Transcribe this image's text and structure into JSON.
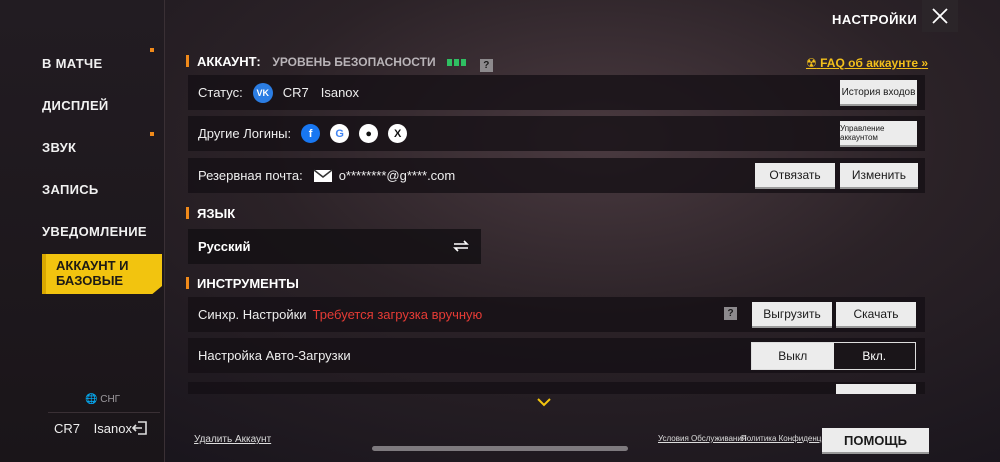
{
  "sidebar": {
    "items": [
      {
        "label": "В МАТЧЕ"
      },
      {
        "label": "ДИСПЛЕЙ"
      },
      {
        "label": "ЗВУК"
      },
      {
        "label": "ЗАПИСЬ"
      },
      {
        "label": "УВЕДОМЛЕНИЕ"
      },
      {
        "label_line1": "АККАУНТ И",
        "label_line2": "БАЗОВЫЕ"
      }
    ],
    "region": "СНГ",
    "user": {
      "clan": "CR7",
      "name": "Isanox"
    }
  },
  "header": {
    "title": "НАСТРОЙКИ"
  },
  "account": {
    "section_title": "АККАУНТ:",
    "security_label": "УРОВЕНЬ БЕЗОПАСНОСТИ",
    "faq_link": "FAQ об аккаунте",
    "status": {
      "label": "Статус:",
      "clan": "CR7",
      "name": "Isanox",
      "vk": "VK",
      "history_button": "История входов"
    },
    "other_logins": {
      "label": "Другие Логины:",
      "manage_button": "Управление аккаунтом"
    },
    "backup_email": {
      "label": "Резервная почта:",
      "value": "o********@g****.com",
      "unbind_button": "Отвязать",
      "change_button": "Изменить"
    }
  },
  "language": {
    "section_title": "ЯЗЫК",
    "current": "Русский"
  },
  "tools": {
    "section_title": "ИНСТРУМЕНТЫ",
    "sync": {
      "label": "Синхр. Настройки",
      "warning": "Требуется загрузка вручную",
      "upload_button": "Выгрузить",
      "download_button": "Скачать"
    },
    "auto_download": {
      "label": "Настройка Авто-Загрузки",
      "off": "Выкл",
      "on": "Вкл."
    }
  },
  "footer": {
    "delete_account": "Удалить Аккаунт",
    "terms": "Условия Обслуживания",
    "privacy": "Политика Конфиденц.",
    "help_button": "ПОМОЩЬ"
  },
  "colors": {
    "accent": "#f2c40f",
    "warning": "#e53b35",
    "secure": "#2fbf62"
  }
}
